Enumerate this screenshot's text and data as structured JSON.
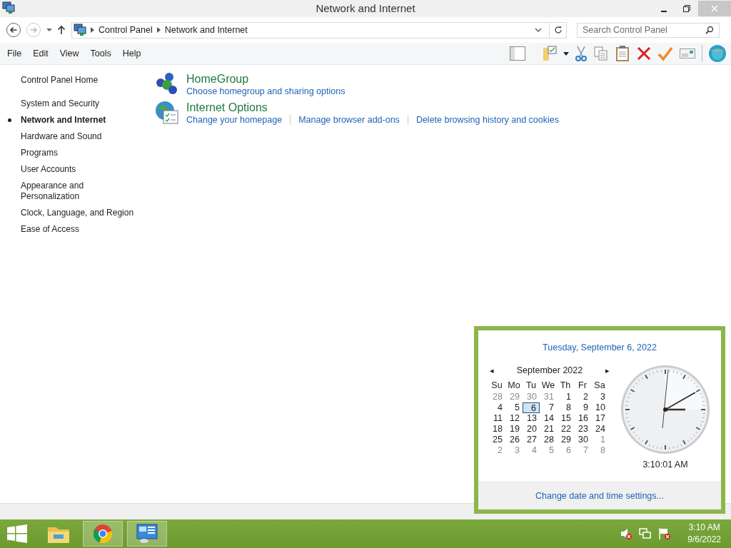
{
  "window": {
    "title": "Network and Internet"
  },
  "address_bar": {
    "breadcrumbs": [
      "Control Panel",
      "Network and Internet"
    ]
  },
  "search": {
    "placeholder": "Search Control Panel"
  },
  "menu": [
    "File",
    "Edit",
    "View",
    "Tools",
    "Help"
  ],
  "sidebar": {
    "home": "Control Panel Home",
    "items": [
      {
        "label": "System and Security",
        "selected": false
      },
      {
        "label": "Network and Internet",
        "selected": true
      },
      {
        "label": "Hardware and Sound",
        "selected": false
      },
      {
        "label": "Programs",
        "selected": false
      },
      {
        "label": "User Accounts",
        "selected": false
      },
      {
        "label": "Appearance and Personalization",
        "selected": false
      },
      {
        "label": "Clock, Language, and Region",
        "selected": false
      },
      {
        "label": "Ease of Access",
        "selected": false
      }
    ]
  },
  "categories": [
    {
      "title": "HomeGroup",
      "links": [
        "Choose homegroup and sharing options"
      ]
    },
    {
      "title": "Internet Options",
      "links": [
        "Change your homepage",
        "Manage browser add-ons",
        "Delete browsing history and cookies"
      ]
    }
  ],
  "calendar_popup": {
    "date_heading": "Tuesday, September 6, 2022",
    "month": "September 2022",
    "prev": "◂",
    "next": "▸",
    "weekdays": [
      "Su",
      "Mo",
      "Tu",
      "We",
      "Th",
      "Fr",
      "Sa"
    ],
    "days": [
      {
        "label": "28",
        "other_month": true,
        "selected": false
      },
      {
        "label": "29",
        "other_month": true,
        "selected": false
      },
      {
        "label": "30",
        "other_month": true,
        "selected": false
      },
      {
        "label": "31",
        "other_month": true,
        "selected": false
      },
      {
        "label": "1",
        "other_month": false,
        "selected": false
      },
      {
        "label": "2",
        "other_month": false,
        "selected": false
      },
      {
        "label": "3",
        "other_month": false,
        "selected": false
      },
      {
        "label": "4",
        "other_month": false,
        "selected": false
      },
      {
        "label": "5",
        "other_month": false,
        "selected": false
      },
      {
        "label": "6",
        "other_month": false,
        "selected": true
      },
      {
        "label": "7",
        "other_month": false,
        "selected": false
      },
      {
        "label": "8",
        "other_month": false,
        "selected": false
      },
      {
        "label": "9",
        "other_month": false,
        "selected": false
      },
      {
        "label": "10",
        "other_month": false,
        "selected": false
      },
      {
        "label": "11",
        "other_month": false,
        "selected": false
      },
      {
        "label": "12",
        "other_month": false,
        "selected": false
      },
      {
        "label": "13",
        "other_month": false,
        "selected": false
      },
      {
        "label": "14",
        "other_month": false,
        "selected": false
      },
      {
        "label": "15",
        "other_month": false,
        "selected": false
      },
      {
        "label": "16",
        "other_month": false,
        "selected": false
      },
      {
        "label": "17",
        "other_month": false,
        "selected": false
      },
      {
        "label": "18",
        "other_month": false,
        "selected": false
      },
      {
        "label": "19",
        "other_month": false,
        "selected": false
      },
      {
        "label": "20",
        "other_month": false,
        "selected": false
      },
      {
        "label": "21",
        "other_month": false,
        "selected": false
      },
      {
        "label": "22",
        "other_month": false,
        "selected": false
      },
      {
        "label": "23",
        "other_month": false,
        "selected": false
      },
      {
        "label": "24",
        "other_month": false,
        "selected": false
      },
      {
        "label": "25",
        "other_month": false,
        "selected": false
      },
      {
        "label": "26",
        "other_month": false,
        "selected": false
      },
      {
        "label": "27",
        "other_month": false,
        "selected": false
      },
      {
        "label": "28",
        "other_month": false,
        "selected": false
      },
      {
        "label": "29",
        "other_month": false,
        "selected": false
      },
      {
        "label": "30",
        "other_month": false,
        "selected": false
      },
      {
        "label": "1",
        "other_month": true,
        "selected": false
      },
      {
        "label": "2",
        "other_month": true,
        "selected": false
      },
      {
        "label": "3",
        "other_month": true,
        "selected": false
      },
      {
        "label": "4",
        "other_month": true,
        "selected": false
      },
      {
        "label": "5",
        "other_month": true,
        "selected": false
      },
      {
        "label": "6",
        "other_month": true,
        "selected": false
      },
      {
        "label": "7",
        "other_month": true,
        "selected": false
      },
      {
        "label": "8",
        "other_month": true,
        "selected": false
      }
    ],
    "time": "3:10:01 AM",
    "settings_link": "Change date and time settings..."
  },
  "taskbar": {
    "clock_time": "3:10 AM",
    "clock_date": "9/6/2022"
  }
}
